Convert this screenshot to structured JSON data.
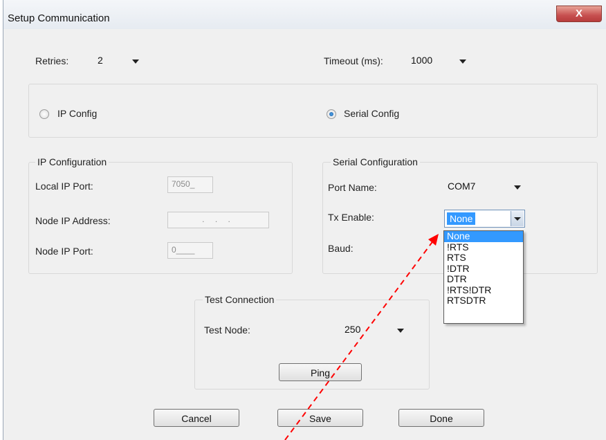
{
  "window": {
    "title": "Setup Communication",
    "close_label": "X"
  },
  "top": {
    "retries_label": "Retries:",
    "retries_value": "2",
    "timeout_label": "Timeout (ms):",
    "timeout_value": "1000"
  },
  "mode": {
    "ip_label": "IP Config",
    "serial_label": "Serial Config",
    "selected": "serial"
  },
  "ip_config": {
    "title": "IP Configuration",
    "local_port_label": "Local IP Port:",
    "local_port_value": "7050_",
    "node_address_label": "Node IP Address:",
    "node_address_value": ". . .",
    "node_port_label": "Node IP Port:",
    "node_port_value": "0____"
  },
  "serial_config": {
    "title": "Serial Configuration",
    "port_name_label": "Port Name:",
    "port_name_value": "COM7",
    "tx_enable_label": "Tx Enable:",
    "tx_enable_value": "None",
    "baud_label": "Baud:",
    "tx_options": [
      "None",
      "!RTS",
      "RTS",
      "!DTR",
      "DTR",
      "!RTS!DTR",
      "RTSDTR"
    ]
  },
  "test": {
    "title": "Test Connection",
    "node_label": "Test Node:",
    "node_value": "250",
    "ping_label": "Ping"
  },
  "buttons": {
    "cancel": "Cancel",
    "save": "Save",
    "done": "Done"
  },
  "colors": {
    "selection": "#3399ff",
    "annotation_arrow": "#ff0000"
  }
}
